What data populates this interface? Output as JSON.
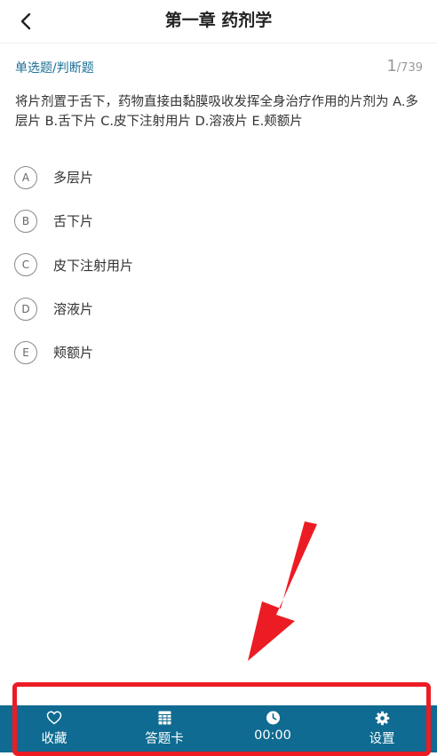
{
  "header": {
    "title": "第一章 药剂学",
    "back_icon": "chevron-left-icon"
  },
  "question": {
    "type_label": "单选题/判断题",
    "current": "1",
    "total": "/739",
    "text": "将片剂置于舌下，药物直接由黏膜吸收发挥全身治疗作用的片剂为 A.多层片 B.舌下片 C.皮下注射用片 D.溶液片 E.颊额片"
  },
  "options": [
    {
      "letter": "A",
      "text": "多层片"
    },
    {
      "letter": "B",
      "text": "舌下片"
    },
    {
      "letter": "C",
      "text": "皮下注射用片"
    },
    {
      "letter": "D",
      "text": "溶液片"
    },
    {
      "letter": "E",
      "text": "颊额片"
    }
  ],
  "toolbar": {
    "favorite": {
      "label": "收藏",
      "icon": "heart-icon"
    },
    "answer_card": {
      "label": "答题卡",
      "icon": "grid-icon"
    },
    "timer": {
      "label": "00:00",
      "icon": "clock-icon"
    },
    "settings": {
      "label": "设置",
      "icon": "gear-icon"
    }
  },
  "colors": {
    "accent": "#1c6f98",
    "toolbar_bg": "#0f6b91",
    "annotation": "#ec1c24"
  }
}
